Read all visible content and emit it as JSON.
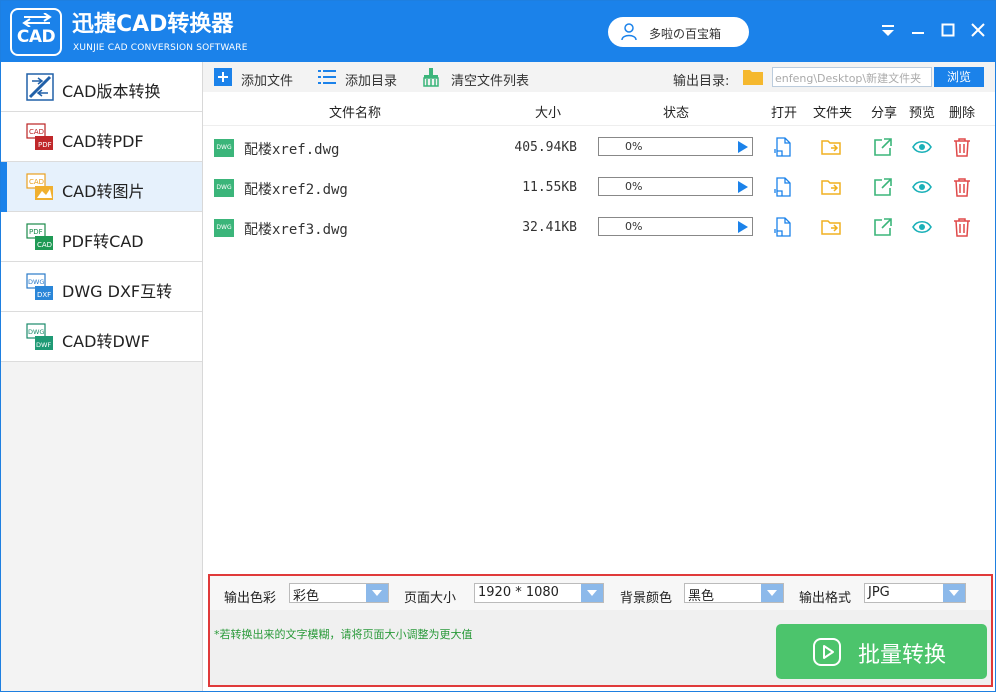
{
  "app": {
    "logo_text": "CAD",
    "title": "迅捷CAD转换器",
    "subtitle": "XUNJIE CAD CONVERSION SOFTWARE",
    "user_name": "多啦の百宝箱",
    "accent_color": "#1b82ea"
  },
  "sidebar": {
    "items": [
      {
        "label": "CAD版本转换",
        "icon": "cad-version-icon",
        "active": false
      },
      {
        "label": "CAD转PDF",
        "icon": "cad-to-pdf-icon",
        "active": false
      },
      {
        "label": "CAD转图片",
        "icon": "cad-to-image-icon",
        "active": true
      },
      {
        "label": "PDF转CAD",
        "icon": "pdf-to-cad-icon",
        "active": false
      },
      {
        "label": "DWG DXF互转",
        "icon": "dwg-dxf-icon",
        "active": false
      },
      {
        "label": "CAD转DWF",
        "icon": "cad-to-dwf-icon",
        "active": false
      }
    ]
  },
  "toolbar": {
    "add_file": "添加文件",
    "add_dir": "添加目录",
    "clear_list": "清空文件列表",
    "output_label": "输出目录:",
    "output_path": "enfeng\\Desktop\\新建文件夹",
    "browse": "浏览"
  },
  "table": {
    "headers": {
      "name": "文件名称",
      "size": "大小",
      "status": "状态",
      "open": "打开",
      "folder": "文件夹",
      "share": "分享",
      "preview": "预览",
      "delete": "删除"
    },
    "file_badge": "DWG",
    "rows": [
      {
        "name": "配楼xref.dwg",
        "size": "405.94KB",
        "progress": "0%"
      },
      {
        "name": "配楼xref2.dwg",
        "size": "11.55KB",
        "progress": "0%"
      },
      {
        "name": "配楼xref3.dwg",
        "size": "32.41KB",
        "progress": "0%"
      }
    ]
  },
  "options": {
    "color_label": "输出色彩",
    "color_value": "彩色",
    "page_label": "页面大小",
    "page_value": "1920 * 1080",
    "bg_label": "背景颜色",
    "bg_value": "黑色",
    "format_label": "输出格式",
    "format_value": "JPG",
    "hint": "*若转换出来的文字模糊，请将页面大小调整为更大值",
    "batch_button": "批量转换"
  }
}
